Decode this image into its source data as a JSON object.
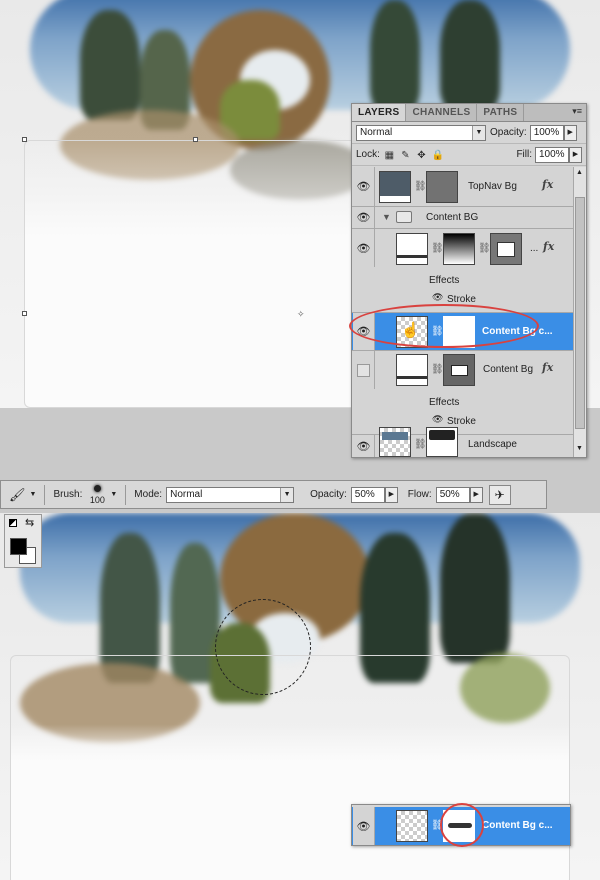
{
  "layers_panel": {
    "tabs": [
      "LAYERS",
      "CHANNELS",
      "PATHS"
    ],
    "menu_glyph": "▾≡",
    "blend_mode": "Normal",
    "opacity_label": "Opacity:",
    "opacity_value": "100%",
    "lock_label": "Lock:",
    "fill_label": "Fill:",
    "fill_value": "100%",
    "layers": [
      {
        "name": "TopNav Bg",
        "fx": "fx"
      },
      {
        "name": "Content BG"
      },
      {
        "name": "...",
        "fx": "fx",
        "effects_label": "Effects",
        "effect": "Stroke"
      },
      {
        "name": "Content Bg c...",
        "selected": true
      },
      {
        "name": "Content Bg",
        "fx": "fx",
        "effects_label": "Effects",
        "effect": "Stroke"
      },
      {
        "name": "Landscape"
      }
    ]
  },
  "options_bar": {
    "brush_label": "Brush:",
    "brush_size": "100",
    "mode_label": "Mode:",
    "mode_value": "Normal",
    "opacity_label": "Opacity:",
    "opacity_value": "50%",
    "flow_label": "Flow:",
    "flow_value": "50%"
  },
  "mini_panel": {
    "layer_name": "Content Bg c..."
  },
  "colors": {
    "selection": "#3a8ee6",
    "highlight_oval": "#d9423f"
  },
  "icons": [
    "eye-icon",
    "chain-icon",
    "folder-icon",
    "brush-tool-icon",
    "airbrush-icon",
    "hand-cursor-icon",
    "swap-colors-icon"
  ]
}
